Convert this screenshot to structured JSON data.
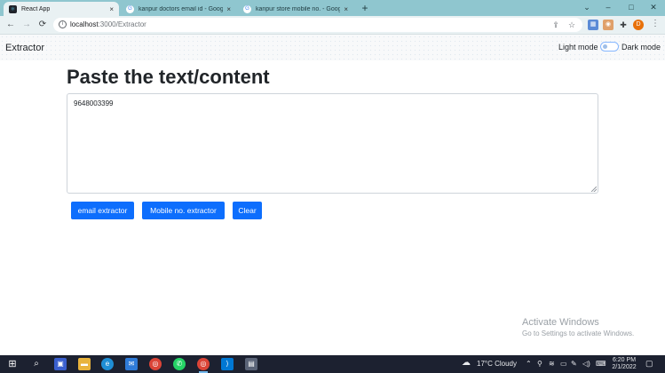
{
  "browser": {
    "tabs": [
      {
        "title": "React App",
        "active": true
      },
      {
        "title": "kanpur doctors email id - Google S",
        "active": false
      },
      {
        "title": "kanpur store mobile no. - Google S",
        "active": false
      }
    ],
    "tab_close": "×",
    "new_tab": "+",
    "window_controls": {
      "minimize": "–",
      "maximize": "□",
      "close": "✕",
      "dropdown": "⌄"
    },
    "nav": {
      "back": "←",
      "forward": "→",
      "reload": "⟳"
    },
    "url": {
      "host": "localhost",
      "rest": ":3000/Extractor"
    },
    "profile_initial": "D"
  },
  "app": {
    "brand": "Extractor",
    "light_mode_label": "Light mode",
    "dark_mode_label": "Dark mode",
    "dark_mode_enabled": false,
    "heading": "Paste the text/content",
    "textarea_value": "9648003399",
    "buttons": {
      "email": "email extractor",
      "mobile": "Mobile no. extractor",
      "clear": "Clear"
    },
    "accent_color": "#0d6efd"
  },
  "watermark": {
    "title": "Activate Windows",
    "subtitle": "Go to Settings to activate Windows."
  },
  "taskbar": {
    "weather": "17°C  Cloudy",
    "time": "6:20 PM",
    "date": "2/1/2022"
  }
}
